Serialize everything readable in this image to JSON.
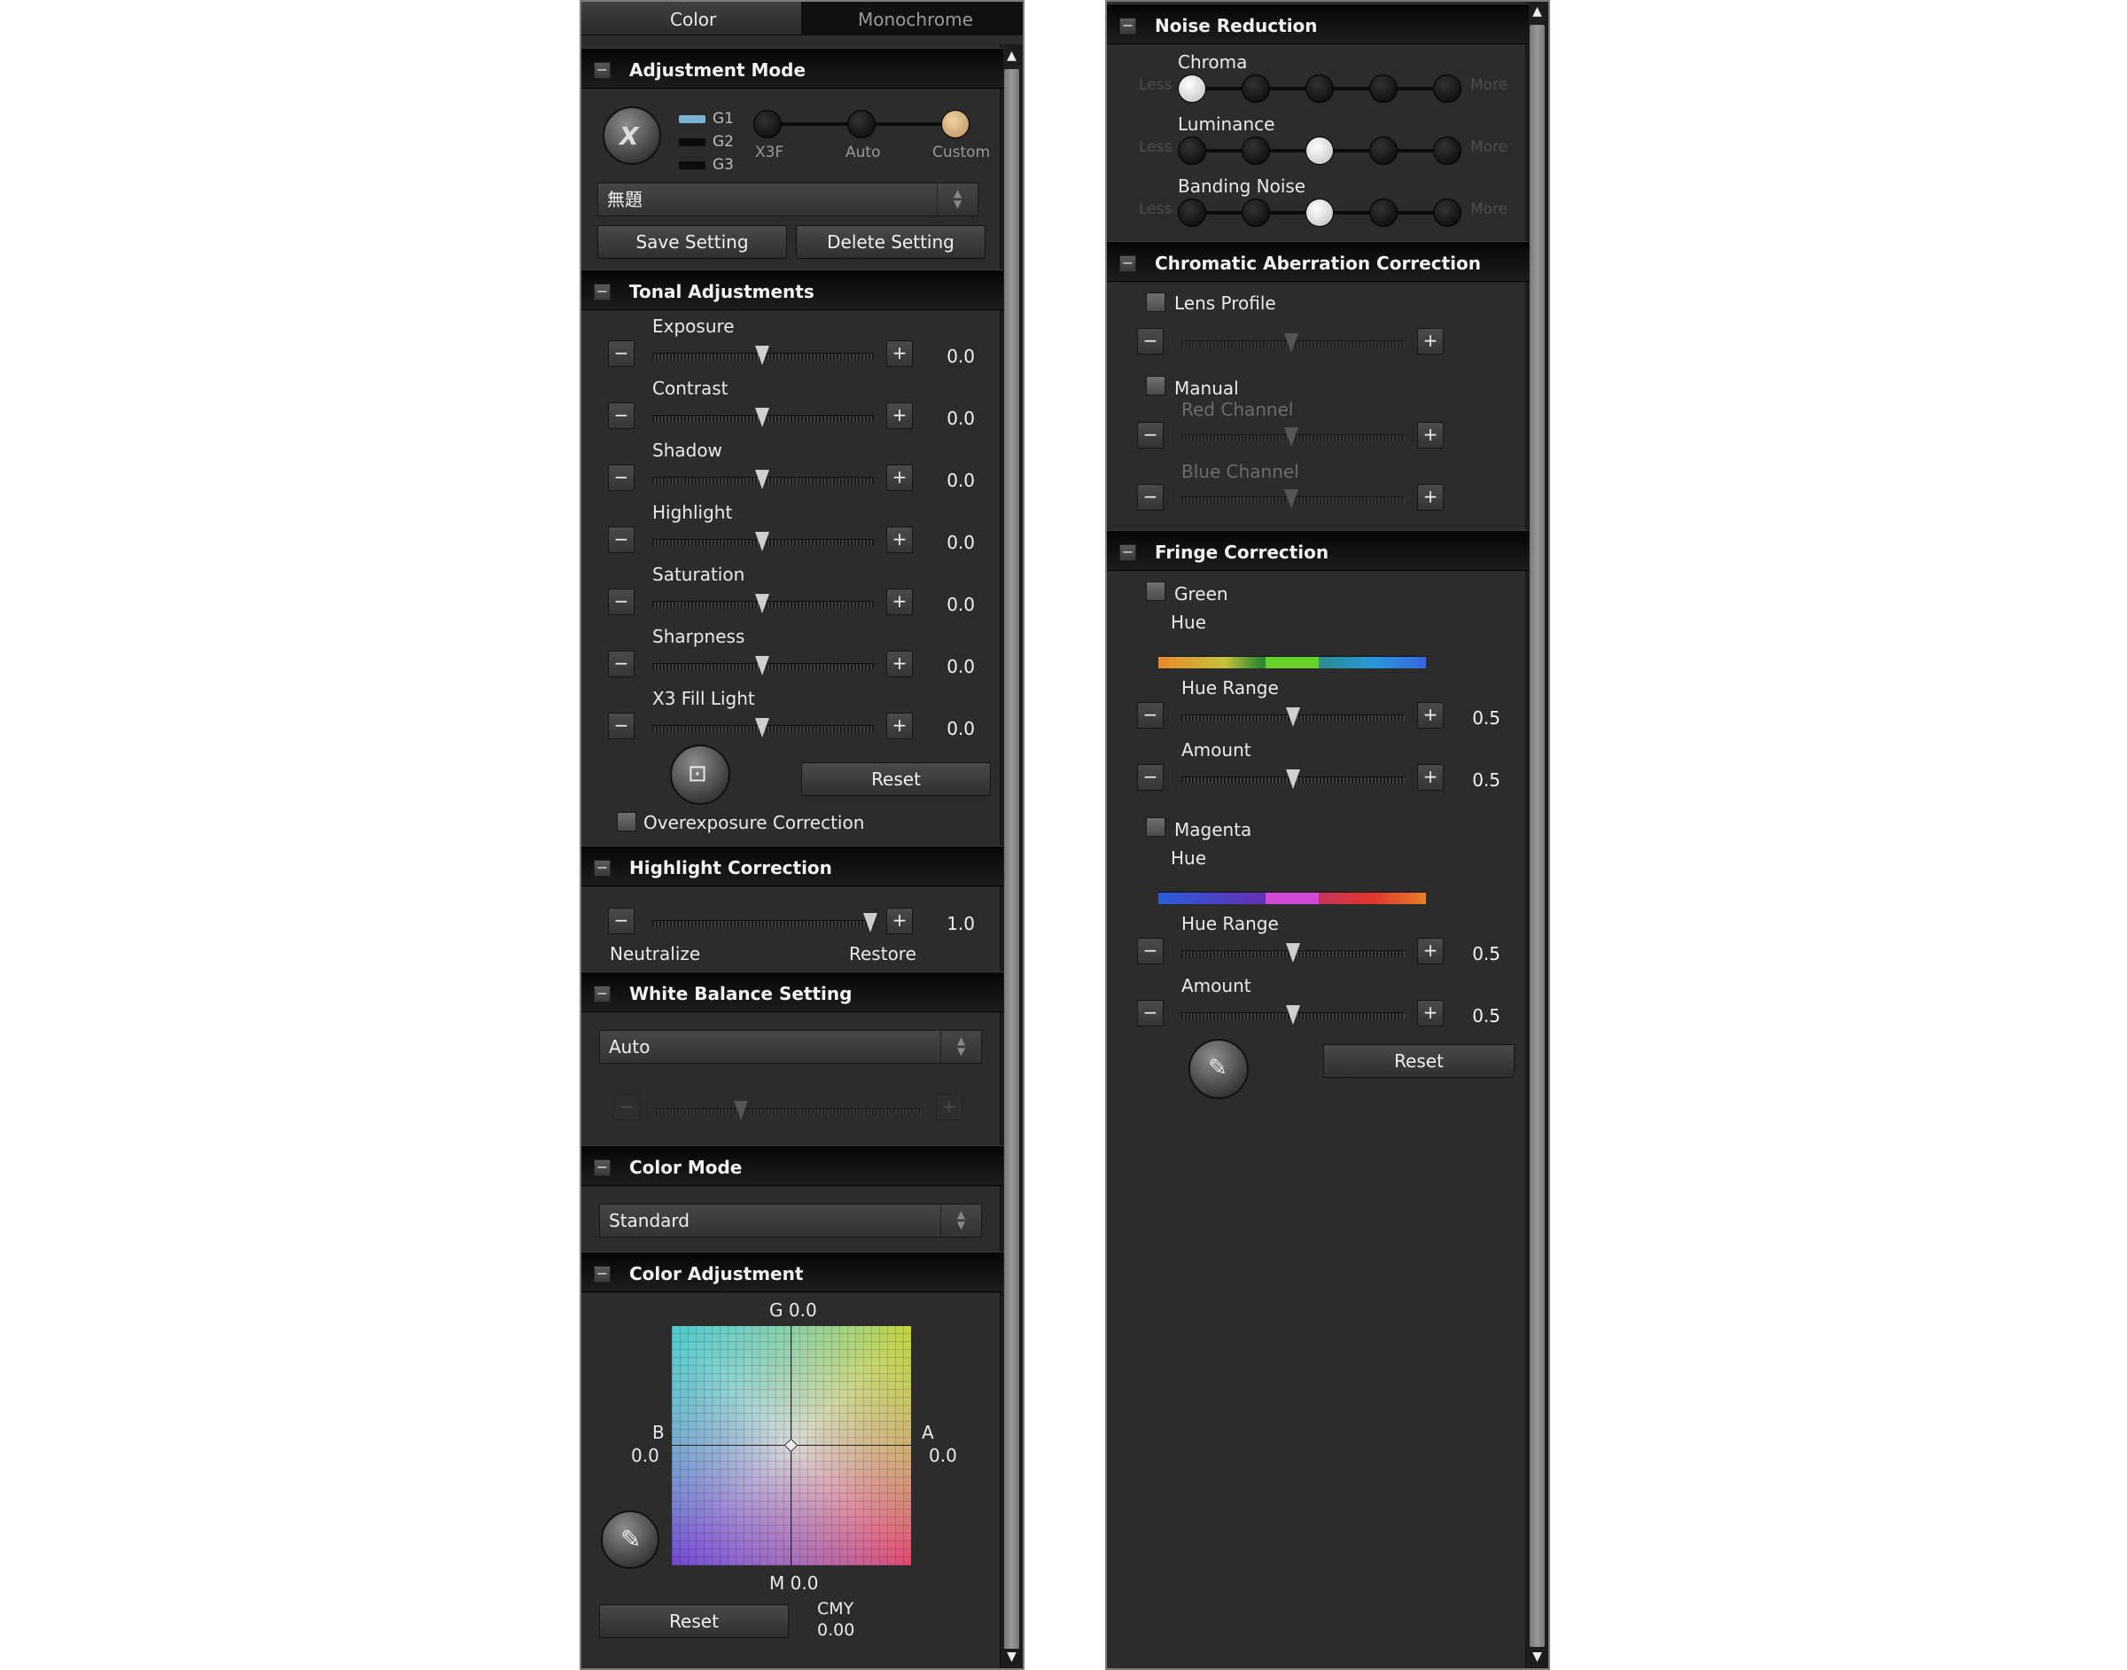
{
  "tabs": [
    "Color",
    "Monochrome"
  ],
  "adjustment_mode": {
    "title": "Adjustment Mode",
    "g_labels": [
      "G1",
      "G2",
      "G3"
    ],
    "modes": [
      "X3F",
      "Auto",
      "Custom"
    ],
    "setting_name": "無題",
    "save": "Save Setting",
    "delete": "Delete Setting"
  },
  "tonal": {
    "title": "Tonal Adjustments",
    "sliders": [
      {
        "label": "Exposure",
        "value": "0.0"
      },
      {
        "label": "Contrast",
        "value": "0.0"
      },
      {
        "label": "Shadow",
        "value": "0.0"
      },
      {
        "label": "Highlight",
        "value": "0.0"
      },
      {
        "label": "Saturation",
        "value": "0.0"
      },
      {
        "label": "Sharpness",
        "value": "0.0"
      },
      {
        "label": "X3 Fill Light",
        "value": "0.0"
      }
    ],
    "reset": "Reset",
    "overexposure": "Overexposure Correction"
  },
  "highlight_correction": {
    "title": "Highlight Correction",
    "value": "1.0",
    "left": "Neutralize",
    "right": "Restore"
  },
  "white_balance": {
    "title": "White Balance Setting",
    "value": "Auto"
  },
  "color_mode": {
    "title": "Color Mode",
    "value": "Standard"
  },
  "color_adjustment": {
    "title": "Color Adjustment",
    "g": "G 0.0",
    "m": "M 0.0",
    "b": "B",
    "b_val": "0.0",
    "a": "A",
    "a_val": "0.0",
    "reset": "Reset",
    "cmy": "CMY",
    "cmy_val": "0.00"
  },
  "noise_reduction": {
    "title": "Noise Reduction",
    "rows": [
      {
        "label": "Chroma",
        "selected": 0
      },
      {
        "label": "Luminance",
        "selected": 2
      },
      {
        "label": "Banding Noise",
        "selected": 2
      }
    ],
    "less": "Less",
    "more": "More"
  },
  "chromatic": {
    "title": "Chromatic Aberration Correction",
    "lens_profile": "Lens Profile",
    "manual": "Manual",
    "red": "Red Channel",
    "blue": "Blue Channel"
  },
  "fringe": {
    "title": "Fringe Correction",
    "green": "Green",
    "magenta": "Magenta",
    "hue": "Hue",
    "hue_range": "Hue Range",
    "amount": "Amount",
    "green_hr": "0.5",
    "green_amt": "0.5",
    "mag_hr": "0.5",
    "mag_amt": "0.5",
    "reset": "Reset"
  },
  "scroll_up": "▲",
  "scroll_down": "▼"
}
